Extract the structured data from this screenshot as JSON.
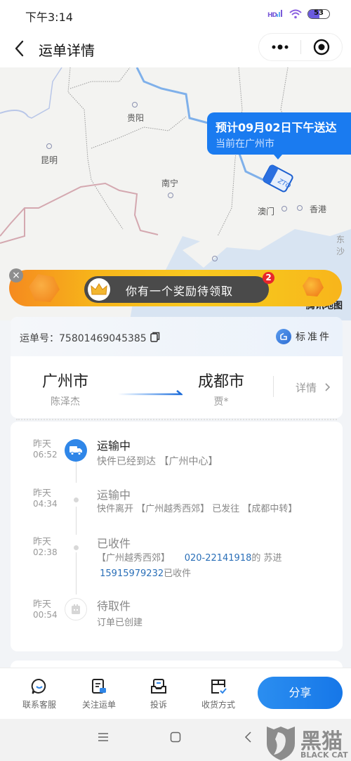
{
  "status_bar": {
    "time": "下午3:14",
    "signal_label": "HD",
    "battery_level": "53",
    "battery_percent": 53
  },
  "nav": {
    "title": "运单详情",
    "back_icon": "chevron-left-icon",
    "more_icon": "more-dots-icon",
    "close_icon": "record-circle-icon"
  },
  "map": {
    "cities": [
      "贵阳",
      "昆明",
      "南宁",
      "澳门",
      "香港",
      "东沙"
    ],
    "callout": {
      "eta": "预计09月02日下午送达",
      "current": "当前在广州市"
    },
    "provider_logo": "腾讯地图"
  },
  "reward_banner": {
    "text": "你有一个奖励待领取",
    "badge_count": "2",
    "close_label": "×"
  },
  "shipment": {
    "waybill_label": "运单号：",
    "waybill_number": "75801469045385",
    "service_type": "标准件",
    "origin_city": "广州市",
    "origin_person": "陈泽杰",
    "destination_city": "成都市",
    "destination_person": "贾*",
    "details_label": "详情"
  },
  "timeline": [
    {
      "day": "昨天",
      "time": "06:52",
      "status": "运输中",
      "description": "快件已经到达 【广州中心】",
      "icon": "truck-icon",
      "active": true
    },
    {
      "day": "昨天",
      "time": "04:34",
      "status": "运输中",
      "description": "快件离开 【广州越秀西郊】 已发往 【成都中转】",
      "active": false
    },
    {
      "day": "昨天",
      "time": "02:38",
      "status": "已收件",
      "description_prefix": "【广州越秀西郊】",
      "phone_1": "020-22141918",
      "description_mid": "的 苏进",
      "phone_2": "15915979232",
      "description_suffix": "已收件",
      "active": false
    },
    {
      "day": "昨天",
      "time": "00:54",
      "status": "待取件",
      "description": "订单已创建",
      "icon": "clipboard-icon",
      "active": false
    }
  ],
  "bottom_bar": {
    "items": [
      {
        "label": "联系客服",
        "icon": "chat-bubble-icon"
      },
      {
        "label": "关注运单",
        "icon": "follow-waybill-icon"
      },
      {
        "label": "投诉",
        "icon": "complaint-icon"
      },
      {
        "label": "收货方式",
        "icon": "delivery-method-icon"
      }
    ],
    "share_label": "分享"
  },
  "watermark": {
    "text": "黑猫",
    "subtext": "BLACK CAT"
  },
  "colors": {
    "accent": "#1a7bf0",
    "link": "#2a6fb8",
    "badge": "#e8262b",
    "banner": "#f8c81f"
  }
}
